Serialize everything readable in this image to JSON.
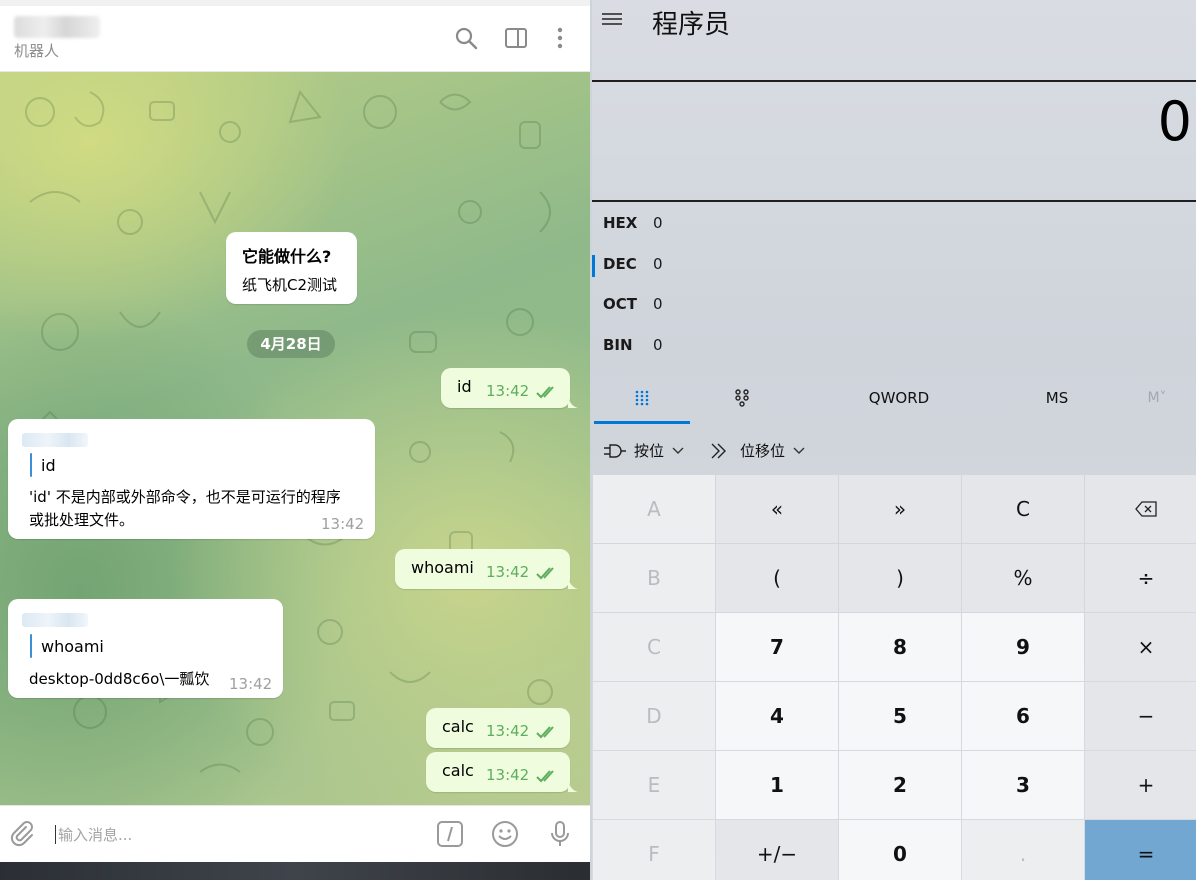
{
  "telegram": {
    "header": {
      "subtitle": "机器人"
    },
    "messages": {
      "info_title": "它能做什么?",
      "info_text": "纸飞机C2测试",
      "date": "4月28日",
      "m1_text": "id",
      "m1_time": "13:42",
      "r1_quote": "id",
      "r1_line1": "'id' 不是内部或外部命令，也不是可运行的程序",
      "r1_line2": "或批处理文件。",
      "r1_time": "13:42",
      "m2_text": "whoami",
      "m2_time": "13:42",
      "r2_quote": "whoami",
      "r2_text": "desktop-0dd8c6o\\一瓢饮",
      "r2_time": "13:42",
      "m3_text": "calc",
      "m3_time": "13:42",
      "m4_text": "calc",
      "m4_time": "13:42"
    },
    "input": {
      "placeholder": "输入消息..."
    },
    "colors": {
      "outgoing_bubble": "#effdde",
      "read_ticks": "#5eae5e",
      "quote_bar": "#3a8fd6"
    }
  },
  "calculator": {
    "title": "程序员",
    "display": "0",
    "radix": [
      {
        "name": "HEX",
        "value": "0"
      },
      {
        "name": "DEC",
        "value": "0"
      },
      {
        "name": "OCT",
        "value": "0"
      },
      {
        "name": "BIN",
        "value": "0"
      }
    ],
    "selected_radix": "DEC",
    "mode_tabs": {
      "word_size": "QWORD",
      "ms": "MS",
      "mplus": "M˅"
    },
    "bitwise": {
      "bitwise_label": "按位",
      "shift_label": "位移位"
    },
    "keys": {
      "r1": [
        "A",
        "«",
        "»",
        "C",
        "⌫"
      ],
      "r2": [
        "B",
        "(",
        ")",
        "%",
        "÷"
      ],
      "r3": [
        "C",
        "7",
        "8",
        "9",
        "×"
      ],
      "r4": [
        "D",
        "4",
        "5",
        "6",
        "−"
      ],
      "r5": [
        "E",
        "1",
        "2",
        "3",
        "+"
      ],
      "r6": [
        "F",
        "+/−",
        "0",
        ".",
        "="
      ]
    },
    "colors": {
      "accent": "#0078d7",
      "equals": "#72a7d1"
    }
  }
}
